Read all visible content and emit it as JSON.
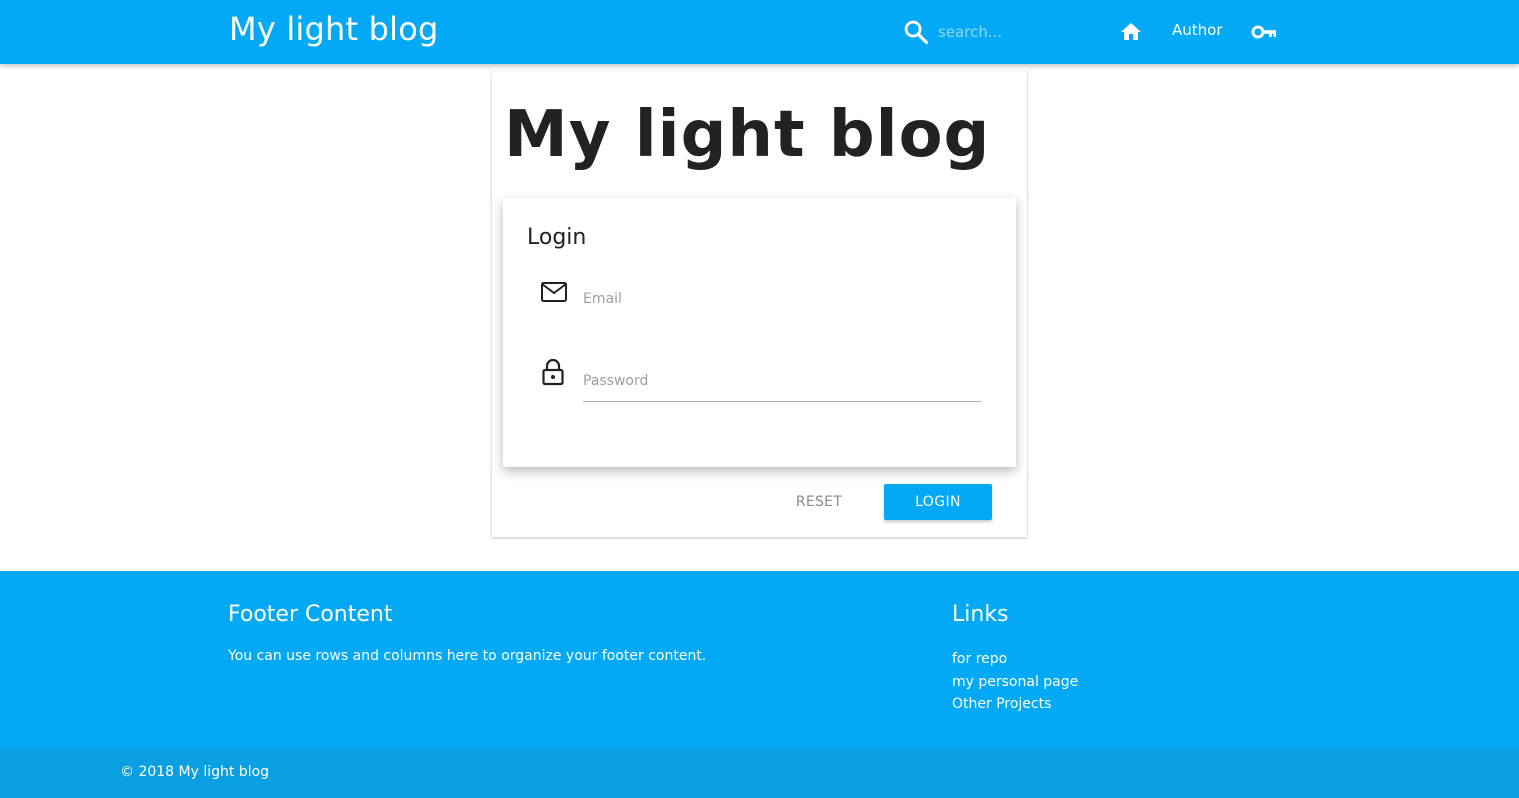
{
  "header": {
    "brand": "My light blog",
    "search_placeholder": "search...",
    "nav": {
      "home_icon": "home-icon",
      "author_label": "Author",
      "login_icon": "key-icon"
    }
  },
  "main": {
    "title": "My light blog",
    "login": {
      "title": "Login",
      "email_icon": "email-icon",
      "email_placeholder": "Email",
      "password_icon": "lock-icon",
      "password_placeholder": "Password",
      "reset_label": "RESET",
      "login_label": "LOGIN"
    }
  },
  "footer": {
    "title": "Footer Content",
    "text": "You can use rows and columns here to organize your footer content.",
    "links_title": "Links",
    "links": [
      "for repo",
      "my personal page",
      "Other Projects"
    ],
    "copyright": "© 2018 My light blog"
  },
  "colors": {
    "primary": "#03a9f4",
    "copyright_bar": "#0a9fe0"
  }
}
